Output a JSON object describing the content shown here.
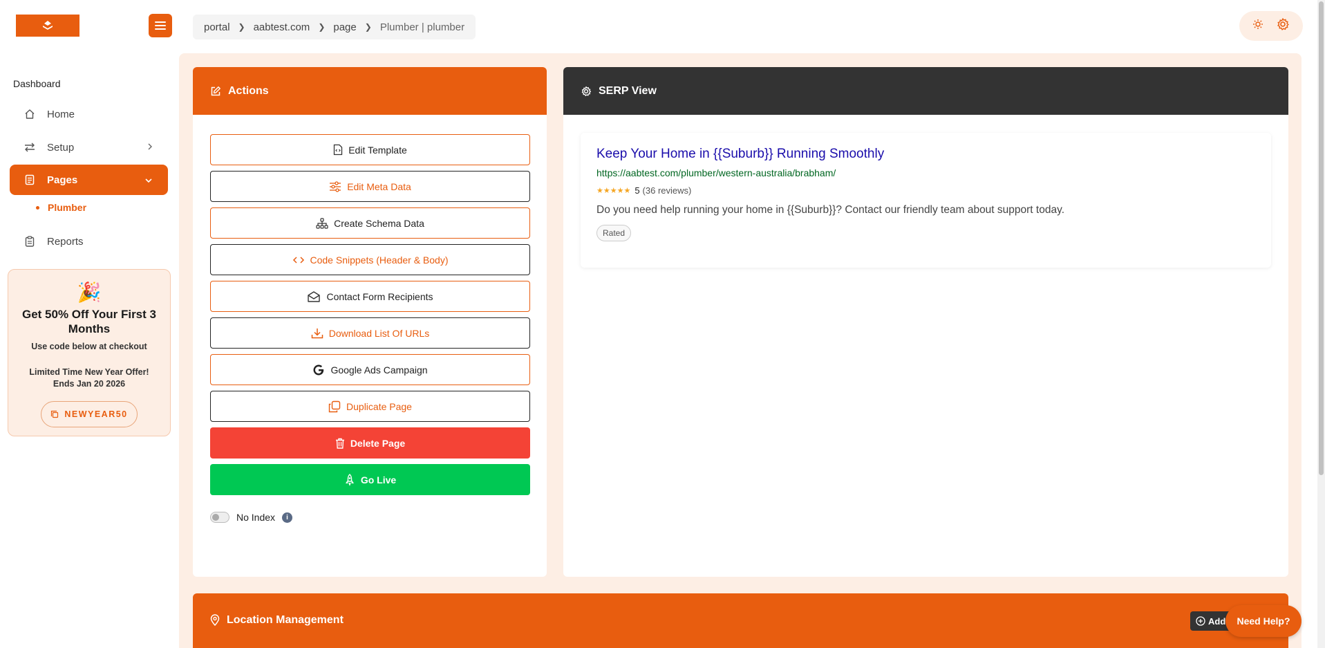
{
  "breadcrumb": [
    "portal",
    "aabtest.com",
    "page",
    "Plumber | plumber"
  ],
  "sidebar": {
    "heading": "Dashboard",
    "items": [
      {
        "label": "Home",
        "icon": "home-icon"
      },
      {
        "label": "Setup",
        "icon": "swap-icon"
      },
      {
        "label": "Pages",
        "icon": "document-icon"
      },
      {
        "label": "Reports",
        "icon": "clipboard-icon"
      }
    ],
    "sub_item": "Plumber"
  },
  "promo": {
    "title": "Get 50% Off Your First 3 Months",
    "subtitle": "Use code below at checkout",
    "offer_line1": "Limited Time New Year Offer!",
    "offer_line2": "Ends Jan 20 2026",
    "code": "NEWYEAR50"
  },
  "actions": {
    "title": "Actions",
    "buttons": [
      {
        "label": "Edit Template",
        "icon": "file-code-icon"
      },
      {
        "label": "Edit Meta Data",
        "icon": "sliders-icon"
      },
      {
        "label": "Create Schema Data",
        "icon": "sitemap-icon"
      },
      {
        "label": "Code Snippets (Header & Body)",
        "icon": "code-icon"
      },
      {
        "label": "Contact Form Recipients",
        "icon": "envelope-icon"
      },
      {
        "label": "Download List Of URLs",
        "icon": "download-icon"
      },
      {
        "label": "Google Ads Campaign",
        "icon": "google-icon"
      },
      {
        "label": "Duplicate Page",
        "icon": "copy-icon"
      },
      {
        "label": "Delete Page",
        "icon": "trash-icon"
      },
      {
        "label": "Go Live",
        "icon": "rocket-icon"
      }
    ],
    "no_index_label": "No Index",
    "no_index_enabled": false
  },
  "serp": {
    "header": "SERP View",
    "title": "Keep Your Home in {{Suburb}} Running Smoothly",
    "url": "https://aabtest.com/plumber/western-australia/brabham/",
    "stars": "★★★★★",
    "rating": "5",
    "reviews": "(36 reviews)",
    "description": "Do you need help running your home in {{Suburb}}? Contact our friendly team about support today.",
    "badge": "Rated"
  },
  "location": {
    "title": "Location Management",
    "add_label": "Add"
  },
  "help_label": "Need Help?",
  "colors": {
    "brand": "#e85d0f",
    "dark": "#333333",
    "danger": "#f44336",
    "success": "#00c853",
    "serp_title": "#1a0dab",
    "serp_url": "#006621"
  }
}
